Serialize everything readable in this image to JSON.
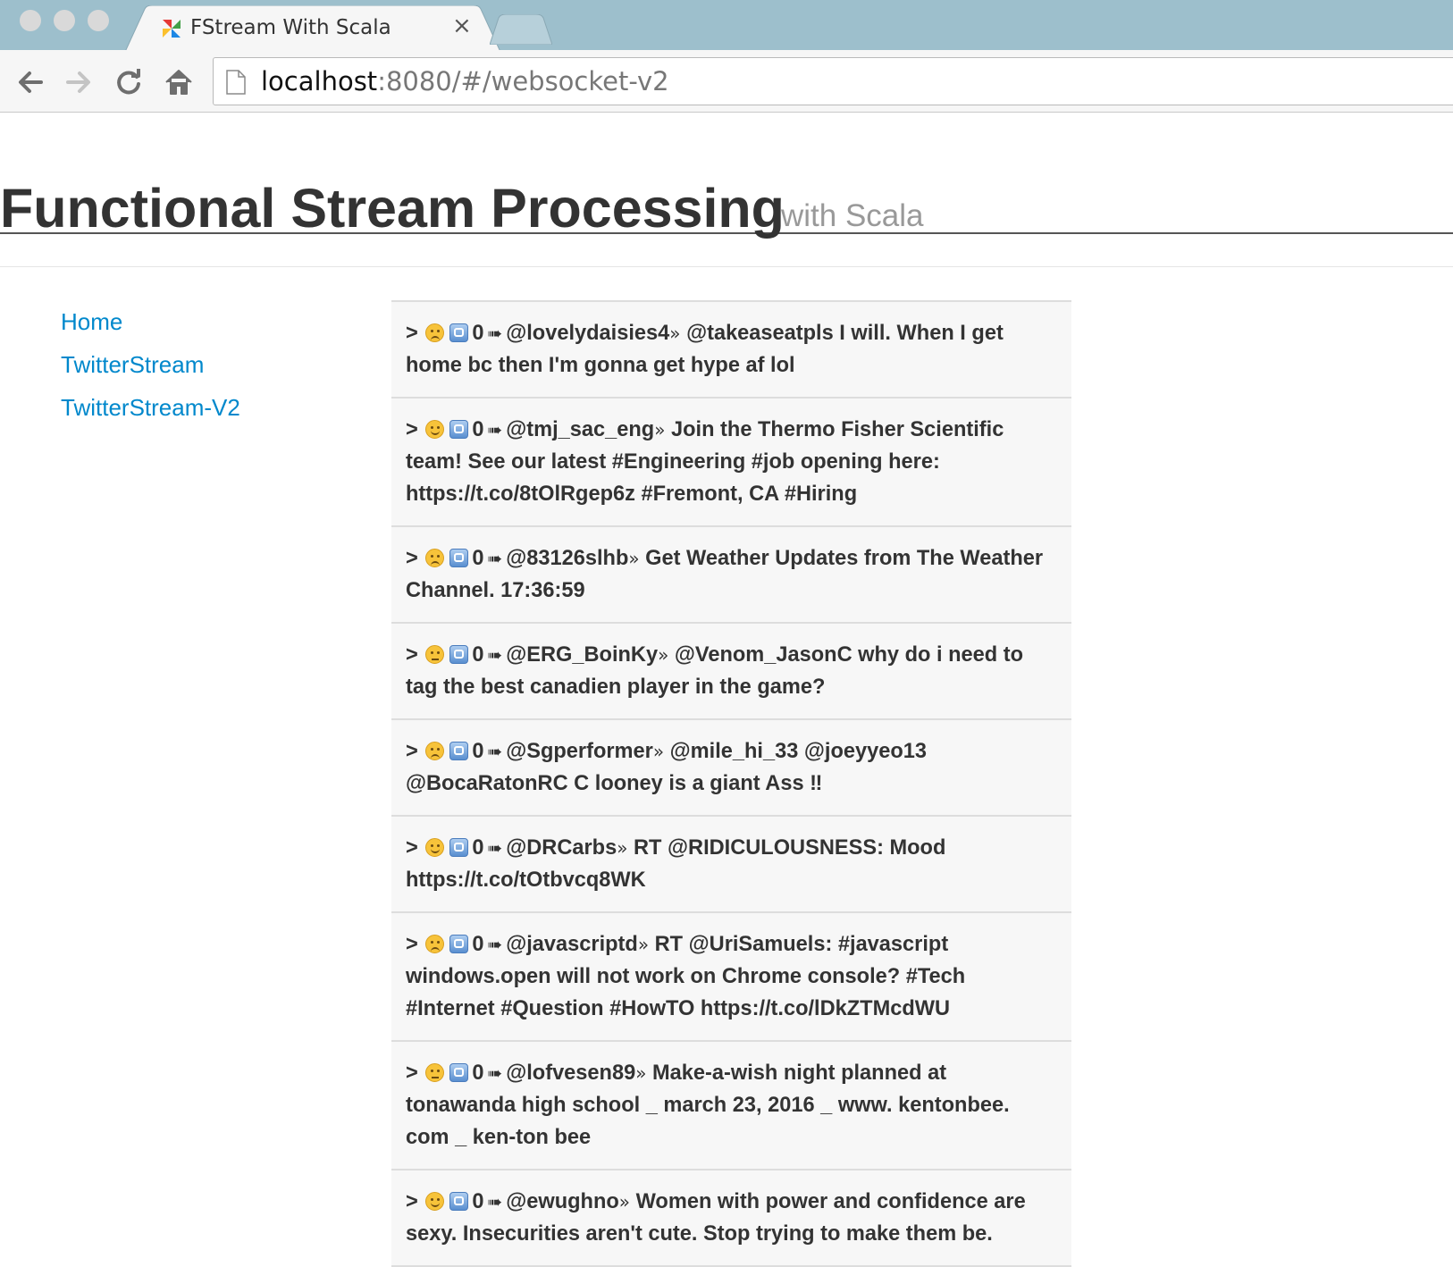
{
  "browser": {
    "tab_title": "FStream With Scala",
    "tab_close": "×",
    "url_host": "localhost",
    "url_rest": ":8080/#/websocket-v2"
  },
  "page": {
    "title": "Functional Stream Processing",
    "subtitle": "with Scala"
  },
  "nav": {
    "items": [
      {
        "label": "Home"
      },
      {
        "label": "TwitterStream"
      },
      {
        "label": "TwitterStream-V2"
      }
    ]
  },
  "feed": {
    "prefix": ">",
    "arrow": "➠",
    "separator": "»",
    "tweets": [
      {
        "sentiment": "sad",
        "count": "0",
        "user": "@lovelydaisies4",
        "text": "@takeaseatpls I will. When I get home bc then I'm gonna get hype af lol"
      },
      {
        "sentiment": "happy",
        "count": "0",
        "user": "@tmj_sac_eng",
        "text": "Join the Thermo Fisher Scientific team! See our latest #Engineering #job opening here: https://t.co/8tOlRgep6z #Fremont, CA #Hiring"
      },
      {
        "sentiment": "sad",
        "count": "0",
        "user": "@83126slhb",
        "text": "Get Weather Updates from The Weather Channel. 17:36:59"
      },
      {
        "sentiment": "unamused",
        "count": "0",
        "user": "@ERG_BoinKy",
        "text": "@Venom_JasonC why do i need to tag the best canadien player in the game?"
      },
      {
        "sentiment": "sad",
        "count": "0",
        "user": "@Sgperformer",
        "text": "@mile_hi_33 @joeyyeo13 @BocaRatonRC C looney is a giant Ass ‼"
      },
      {
        "sentiment": "happy",
        "count": "0",
        "user": "@DRCarbs",
        "text": "RT @RIDICULOUSNESS: Mood https://t.co/tOtbvcq8WK"
      },
      {
        "sentiment": "sad",
        "count": "0",
        "user": "@javascriptd",
        "text": "RT @UriSamuels: #javascript windows.open will not work on Chrome console? #Tech #Internet #Question #HowTO https://t.co/lDkZTMcdWU"
      },
      {
        "sentiment": "unamused",
        "count": "0",
        "user": "@lofvesen89",
        "text": "Make-a-wish night planned at tonawanda high school _ march 23, 2016 _ www. kentonbee. com _ ken-ton bee"
      },
      {
        "sentiment": "happy",
        "count": "0",
        "user": "@ewughno",
        "text": "Women with power and confidence are sexy. Insecurities aren't cute. Stop trying to make them be."
      }
    ]
  }
}
